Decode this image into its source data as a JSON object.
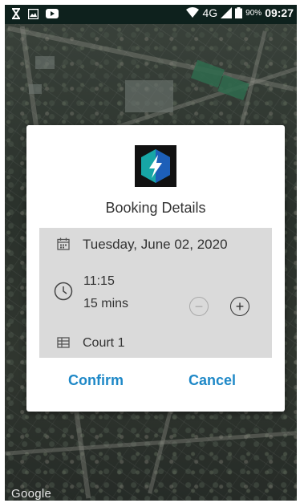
{
  "status_bar": {
    "network": "4G",
    "battery": "90%",
    "time": "09:27",
    "left_icons": [
      "hourglass-icon",
      "image-icon",
      "youtube-icon"
    ]
  },
  "map": {
    "attribution": "Google"
  },
  "dialog": {
    "logo_icon": "app-logo-icon",
    "title": "Booking Details",
    "date": "Tuesday, June 02, 2020",
    "time": "11:15",
    "duration": "15 mins",
    "decrease_symbol": "−",
    "increase_symbol": "+",
    "court": "Court 1",
    "confirm_label": "Confirm",
    "cancel_label": "Cancel"
  },
  "colors": {
    "accent": "#1e88c7",
    "details_bg": "#dadada",
    "status_bar_bg": "#0e211d",
    "logo_teal": "#17a6a6",
    "logo_blue": "#1d5fb8"
  }
}
